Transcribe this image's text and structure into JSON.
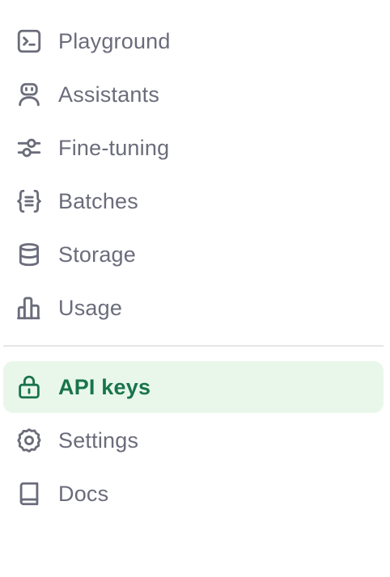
{
  "sidebar": {
    "group_primary": [
      {
        "label": "Playground",
        "icon": "terminal-icon"
      },
      {
        "label": "Assistants",
        "icon": "robot-icon"
      },
      {
        "label": "Fine-tuning",
        "icon": "sliders-icon"
      },
      {
        "label": "Batches",
        "icon": "braces-icon"
      },
      {
        "label": "Storage",
        "icon": "database-icon"
      },
      {
        "label": "Usage",
        "icon": "bar-chart-icon"
      }
    ],
    "group_secondary": [
      {
        "label": "API keys",
        "icon": "lock-icon",
        "active": true
      },
      {
        "label": "Settings",
        "icon": "gear-icon"
      },
      {
        "label": "Docs",
        "icon": "book-icon"
      }
    ]
  },
  "colors": {
    "text": "#6b6c7b",
    "active_text": "#19744a",
    "active_background": "#e9f7ea",
    "divider": "#e6e6e8"
  }
}
